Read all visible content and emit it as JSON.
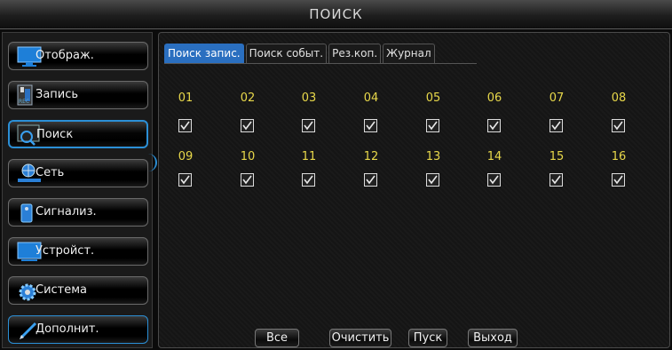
{
  "window": {
    "title": "ПОИСК"
  },
  "sidebar": {
    "items": [
      {
        "label": "Отображ.",
        "icon": "monitor-icon"
      },
      {
        "label": "Запись",
        "icon": "record-icon"
      },
      {
        "label": "Поиск",
        "icon": "search-icon",
        "active": true
      },
      {
        "label": "Сеть",
        "icon": "network-icon"
      },
      {
        "label": "Сигнализ.",
        "icon": "alarm-icon"
      },
      {
        "label": "Устройст.",
        "icon": "device-icon"
      },
      {
        "label": "Система",
        "icon": "gear-icon"
      },
      {
        "label": "Дополнит.",
        "icon": "pen-icon"
      }
    ]
  },
  "tabs": [
    {
      "label": "Поиск запис.",
      "active": true
    },
    {
      "label": "Поиск событ."
    },
    {
      "label": "Рез.коп."
    },
    {
      "label": "Журнал"
    }
  ],
  "channels": [
    {
      "number": "01",
      "checked": true
    },
    {
      "number": "02",
      "checked": true
    },
    {
      "number": "03",
      "checked": true
    },
    {
      "number": "04",
      "checked": true
    },
    {
      "number": "05",
      "checked": true
    },
    {
      "number": "06",
      "checked": true
    },
    {
      "number": "07",
      "checked": true
    },
    {
      "number": "08",
      "checked": true
    },
    {
      "number": "09",
      "checked": true
    },
    {
      "number": "10",
      "checked": true
    },
    {
      "number": "11",
      "checked": true
    },
    {
      "number": "12",
      "checked": true
    },
    {
      "number": "13",
      "checked": true
    },
    {
      "number": "14",
      "checked": true
    },
    {
      "number": "15",
      "checked": true
    },
    {
      "number": "16",
      "checked": true
    }
  ],
  "buttons": {
    "all": "Все",
    "clear": "Очистить",
    "start": "Пуск",
    "exit": "Выход"
  },
  "colors": {
    "accent": "#2b8fd6",
    "tab_active": "#2a6fc0",
    "channel_number": "#e8d84a"
  }
}
